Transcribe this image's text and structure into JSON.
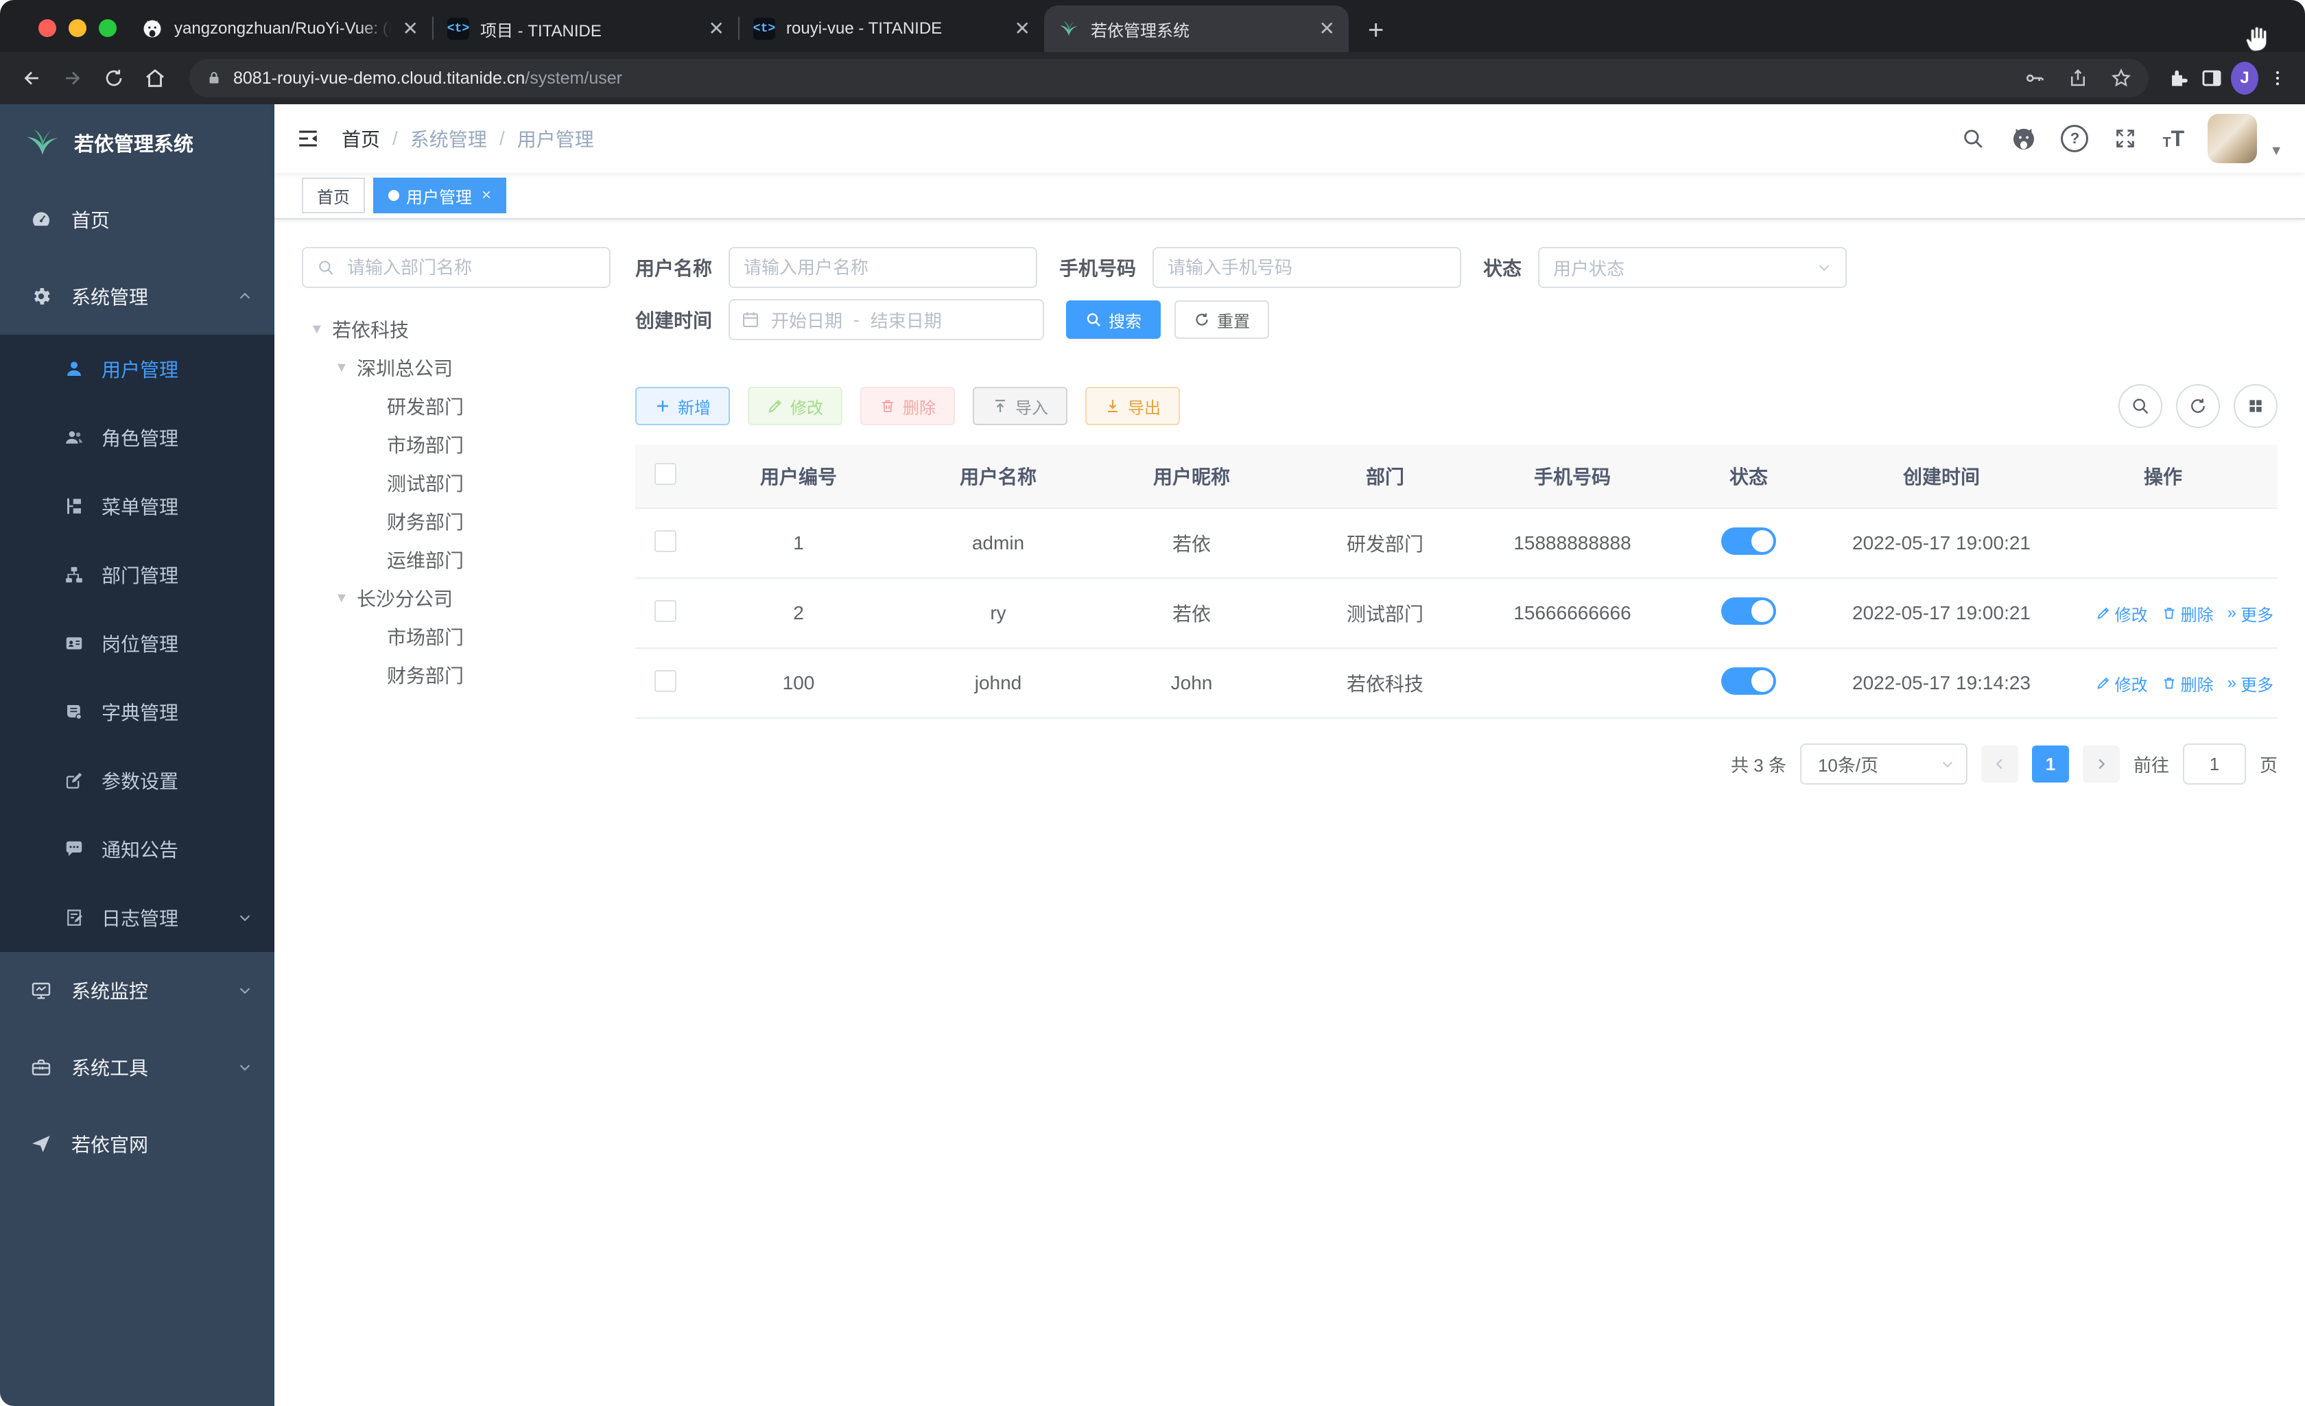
{
  "colors": {
    "accent": "#409eff",
    "sidebar_bg": "#35455a",
    "submenu_bg": "#202b3b",
    "menu_active_text": "#409eff",
    "tag_active_bg": "#449df6",
    "success": "#67c23a",
    "danger": "#f56c6c",
    "warning": "#e6a23c",
    "info": "#909399"
  },
  "browser": {
    "tabs": [
      {
        "title": "yangzongzhuan/RuoYi-Vue: (Ru"
      },
      {
        "title": "项目 - TITANIDE",
        "favicon_glyph": "<t>"
      },
      {
        "title": "rouyi-vue - TITANIDE",
        "favicon_glyph": "<t>"
      },
      {
        "title": "若依管理系统"
      }
    ],
    "url": {
      "host": "8081-rouyi-vue-demo.cloud.titanide.cn",
      "path": "/system/user"
    },
    "profile_initial": "J"
  },
  "sidebar": {
    "title": "若依管理系统",
    "items": [
      {
        "label": "首页"
      },
      {
        "label": "系统管理"
      },
      {
        "label": "用户管理"
      },
      {
        "label": "角色管理"
      },
      {
        "label": "菜单管理"
      },
      {
        "label": "部门管理"
      },
      {
        "label": "岗位管理"
      },
      {
        "label": "字典管理"
      },
      {
        "label": "参数设置"
      },
      {
        "label": "通知公告"
      },
      {
        "label": "日志管理"
      },
      {
        "label": "系统监控"
      },
      {
        "label": "系统工具"
      },
      {
        "label": "若依官网"
      }
    ]
  },
  "breadcrumb": {
    "items": [
      "首页",
      "系统管理",
      "用户管理"
    ]
  },
  "tags": {
    "home": "首页",
    "active": "用户管理",
    "close": "×"
  },
  "tree": {
    "placeholder": "请输入部门名称",
    "nodes": [
      {
        "label": "若依科技"
      },
      {
        "label": "深圳总公司"
      },
      {
        "label": "研发部门"
      },
      {
        "label": "市场部门"
      },
      {
        "label": "测试部门"
      },
      {
        "label": "财务部门"
      },
      {
        "label": "运维部门"
      },
      {
        "label": "长沙分公司"
      },
      {
        "label": "市场部门"
      },
      {
        "label": "财务部门"
      }
    ]
  },
  "query": {
    "username_label": "用户名称",
    "username_placeholder": "请输入用户名称",
    "phone_label": "手机号码",
    "phone_placeholder": "请输入手机号码",
    "status_label": "状态",
    "status_placeholder": "用户状态",
    "date_label": "创建时间",
    "date_start": "开始日期",
    "date_sep": "-",
    "date_end": "结束日期",
    "search_label": "搜索",
    "reset_label": "重置"
  },
  "toolbar": {
    "add": "新增",
    "edit": "修改",
    "delete": "删除",
    "import": "导入",
    "export": "导出"
  },
  "table": {
    "columns": [
      "用户编号",
      "用户名称",
      "用户昵称",
      "部门",
      "手机号码",
      "状态",
      "创建时间",
      "操作"
    ],
    "actions": {
      "edit": "修改",
      "delete": "删除",
      "more": "更多"
    },
    "rows": [
      {
        "id": "1",
        "username": "admin",
        "nickname": "若依",
        "dept": "研发部门",
        "phone": "15888888888",
        "created": "2022-05-17 19:00:21"
      },
      {
        "id": "2",
        "username": "ry",
        "nickname": "若依",
        "dept": "测试部门",
        "phone": "15666666666",
        "created": "2022-05-17 19:00:21"
      },
      {
        "id": "100",
        "username": "johnd",
        "nickname": "John",
        "dept": "若依科技",
        "phone": "",
        "created": "2022-05-17 19:14:23"
      }
    ]
  },
  "pagination": {
    "total": "共 3 条",
    "size": "10条/页",
    "page": "1",
    "goto": "前往",
    "unit": "页",
    "goto_value": "1"
  }
}
